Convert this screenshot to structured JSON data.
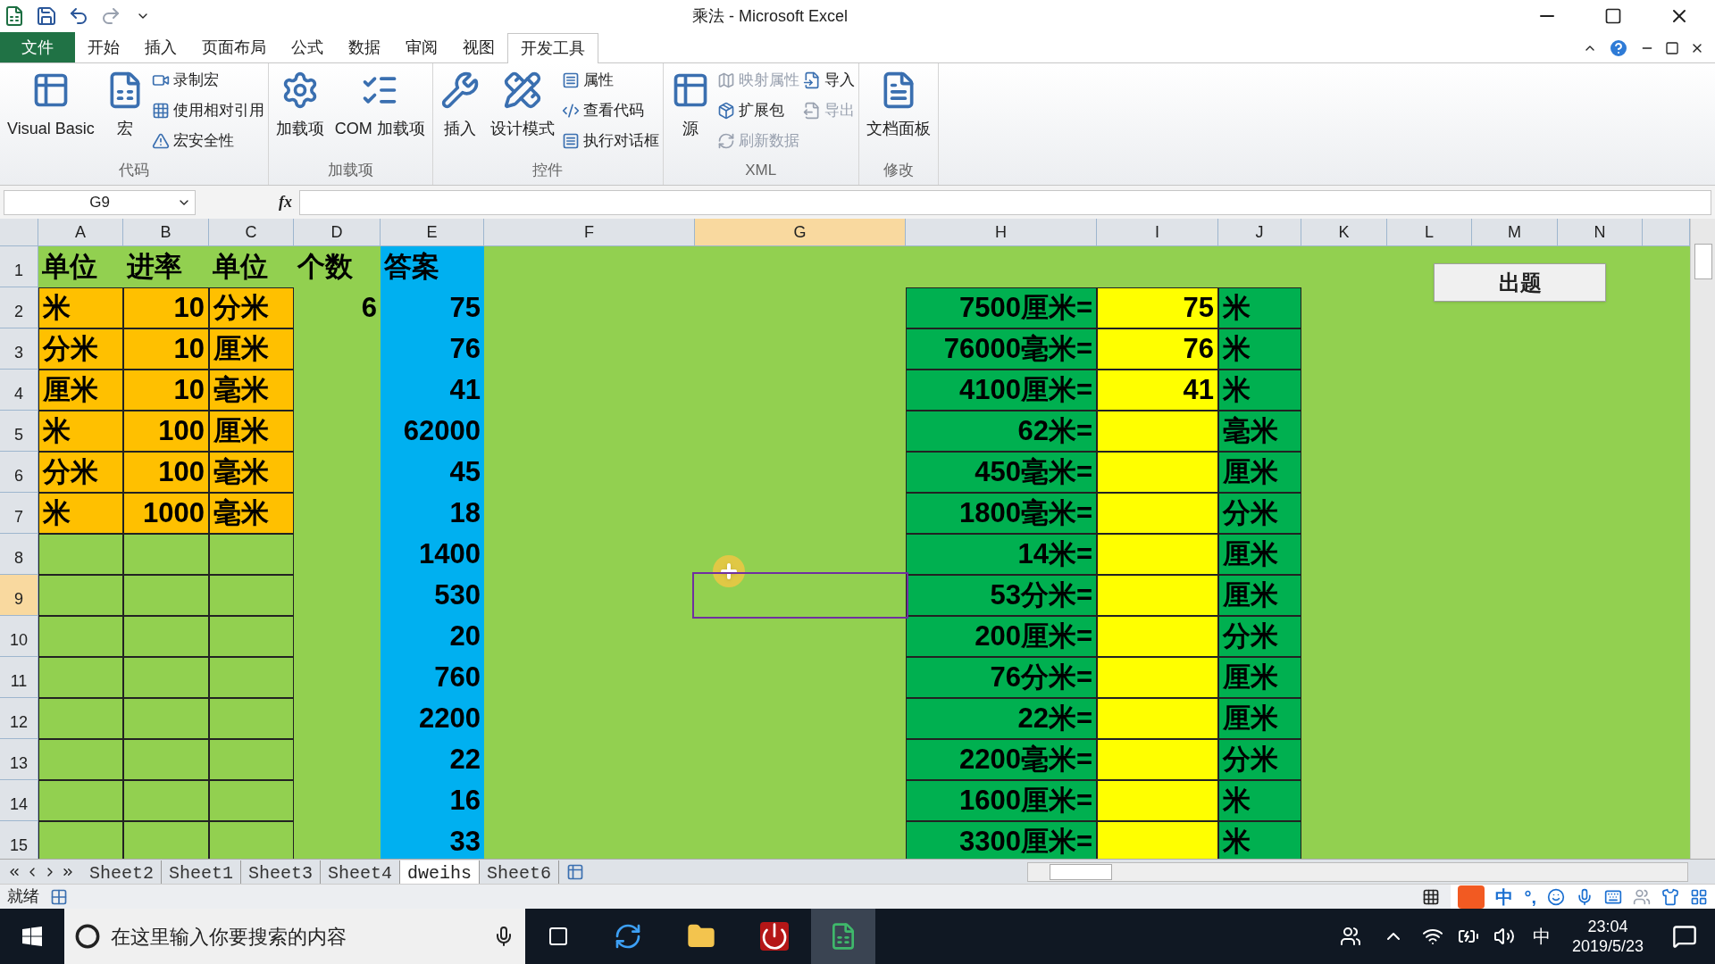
{
  "window": {
    "title": "乘法 - Microsoft Excel"
  },
  "ribbon_tabs": [
    {
      "label": "文件",
      "kind": "file",
      "selected": false
    },
    {
      "label": "开始",
      "kind": "tab",
      "selected": false
    },
    {
      "label": "插入",
      "kind": "tab",
      "selected": false
    },
    {
      "label": "页面布局",
      "kind": "tab",
      "selected": false
    },
    {
      "label": "公式",
      "kind": "tab",
      "selected": false
    },
    {
      "label": "数据",
      "kind": "tab",
      "selected": false
    },
    {
      "label": "审阅",
      "kind": "tab",
      "selected": false
    },
    {
      "label": "视图",
      "kind": "tab",
      "selected": false
    },
    {
      "label": "开发工具",
      "kind": "tab",
      "selected": true
    }
  ],
  "ribbon_groups": [
    {
      "label": "代码",
      "items": [
        {
          "kind": "large",
          "label": "Visual Basic",
          "disabled": false
        },
        {
          "kind": "large",
          "label": "宏",
          "disabled": false
        },
        {
          "kind": "stack",
          "items": [
            {
              "label": "录制宏",
              "disabled": false
            },
            {
              "label": "使用相对引用",
              "disabled": false
            },
            {
              "label": "宏安全性",
              "disabled": false
            }
          ]
        }
      ]
    },
    {
      "label": "加载项",
      "items": [
        {
          "kind": "large",
          "label": "加载项",
          "disabled": false
        },
        {
          "kind": "large",
          "label": "COM 加载项",
          "disabled": false
        }
      ]
    },
    {
      "label": "控件",
      "items": [
        {
          "kind": "large",
          "label": "插入",
          "disabled": false
        },
        {
          "kind": "large",
          "label": "设计模式",
          "disabled": false
        },
        {
          "kind": "stack",
          "items": [
            {
              "label": "属性",
              "disabled": false
            },
            {
              "label": "查看代码",
              "disabled": false
            },
            {
              "label": "执行对话框",
              "disabled": false
            }
          ]
        }
      ]
    },
    {
      "label": "XML",
      "items": [
        {
          "kind": "large",
          "label": "源",
          "disabled": false
        },
        {
          "kind": "stack",
          "items": [
            {
              "label": "映射属性",
              "disabled": true
            },
            {
              "label": "扩展包",
              "disabled": false
            },
            {
              "label": "刷新数据",
              "disabled": true
            }
          ]
        },
        {
          "kind": "stack",
          "items": [
            {
              "label": "导入",
              "disabled": false
            },
            {
              "label": "导出",
              "disabled": true
            }
          ]
        }
      ]
    },
    {
      "label": "修改",
      "items": [
        {
          "kind": "large",
          "label": "文档面板",
          "disabled": false
        }
      ]
    }
  ],
  "formula_bar": {
    "name_box": "G9",
    "fx": "fx"
  },
  "columns": [
    {
      "label": "A",
      "selected": false
    },
    {
      "label": "B",
      "selected": false
    },
    {
      "label": "C",
      "selected": false
    },
    {
      "label": "D",
      "selected": false
    },
    {
      "label": "E",
      "selected": false
    },
    {
      "label": "F",
      "selected": false
    },
    {
      "label": "G",
      "selected": true
    },
    {
      "label": "H",
      "selected": false
    },
    {
      "label": "I",
      "selected": false
    },
    {
      "label": "J",
      "selected": false
    },
    {
      "label": "K",
      "selected": false
    },
    {
      "label": "L",
      "selected": false
    },
    {
      "label": "M",
      "selected": false
    },
    {
      "label": "N",
      "selected": false
    }
  ],
  "rows": [
    {
      "label": "1",
      "selected": false,
      "cells": [
        {
          "text": "单位",
          "kind": "text",
          "color": "#92d050",
          "bordered": false
        },
        {
          "text": "进率",
          "kind": "text",
          "color": "#92d050",
          "bordered": false
        },
        {
          "text": "单位",
          "kind": "text",
          "color": "#92d050",
          "bordered": false
        },
        {
          "text": "个数",
          "kind": "text",
          "color": "#92d050",
          "bordered": false
        },
        {
          "text": "答案",
          "kind": "text",
          "color": "#00b0f0",
          "bordered": false
        },
        null,
        null,
        null,
        null,
        null
      ]
    },
    {
      "label": "2",
      "selected": false,
      "cells": [
        {
          "text": "米",
          "kind": "text",
          "color": "#ffc000",
          "bordered": true
        },
        {
          "text": "10",
          "kind": "number",
          "color": "#ffc000",
          "bordered": true
        },
        {
          "text": "分米",
          "kind": "text",
          "color": "#ffc000",
          "bordered": true
        },
        {
          "text": "6",
          "kind": "number",
          "color": "#92d050",
          "bordered": false
        },
        {
          "text": "75",
          "kind": "number",
          "color": "#00b0f0",
          "bordered": false
        },
        null,
        null,
        {
          "text": "7500厘米=",
          "kind": "number",
          "color": "#00b050",
          "bordered": true
        },
        {
          "text": "75",
          "kind": "number",
          "color": "#ffff00",
          "bordered": true
        },
        {
          "text": "米",
          "kind": "text",
          "color": "#00b050",
          "bordered": true
        }
      ]
    },
    {
      "label": "3",
      "selected": false,
      "cells": [
        {
          "text": "分米",
          "kind": "text",
          "color": "#ffc000",
          "bordered": true
        },
        {
          "text": "10",
          "kind": "number",
          "color": "#ffc000",
          "bordered": true
        },
        {
          "text": "厘米",
          "kind": "text",
          "color": "#ffc000",
          "bordered": true
        },
        null,
        {
          "text": "76",
          "kind": "number",
          "color": "#00b0f0",
          "bordered": false
        },
        null,
        null,
        {
          "text": "76000毫米=",
          "kind": "number",
          "color": "#00b050",
          "bordered": true
        },
        {
          "text": "76",
          "kind": "number",
          "color": "#ffff00",
          "bordered": true
        },
        {
          "text": "米",
          "kind": "text",
          "color": "#00b050",
          "bordered": true
        }
      ]
    },
    {
      "label": "4",
      "selected": false,
      "cells": [
        {
          "text": "厘米",
          "kind": "text",
          "color": "#ffc000",
          "bordered": true
        },
        {
          "text": "10",
          "kind": "number",
          "color": "#ffc000",
          "bordered": true
        },
        {
          "text": "毫米",
          "kind": "text",
          "color": "#ffc000",
          "bordered": true
        },
        null,
        {
          "text": "41",
          "kind": "number",
          "color": "#00b0f0",
          "bordered": false
        },
        null,
        null,
        {
          "text": "4100厘米=",
          "kind": "number",
          "color": "#00b050",
          "bordered": true
        },
        {
          "text": "41",
          "kind": "number",
          "color": "#ffff00",
          "bordered": true
        },
        {
          "text": "米",
          "kind": "text",
          "color": "#00b050",
          "bordered": true
        }
      ]
    },
    {
      "label": "5",
      "selected": false,
      "cells": [
        {
          "text": "米",
          "kind": "text",
          "color": "#ffc000",
          "bordered": true
        },
        {
          "text": "100",
          "kind": "number",
          "color": "#ffc000",
          "bordered": true
        },
        {
          "text": "厘米",
          "kind": "text",
          "color": "#ffc000",
          "bordered": true
        },
        null,
        {
          "text": "62000",
          "kind": "number",
          "color": "#00b0f0",
          "bordered": false
        },
        null,
        null,
        {
          "text": "62米=",
          "kind": "number",
          "color": "#00b050",
          "bordered": true
        },
        {
          "color": "#ffff00",
          "bordered": true
        },
        {
          "text": "毫米",
          "kind": "text",
          "color": "#00b050",
          "bordered": true
        }
      ]
    },
    {
      "label": "6",
      "selected": false,
      "cells": [
        {
          "text": "分米",
          "kind": "text",
          "color": "#ffc000",
          "bordered": true
        },
        {
          "text": "100",
          "kind": "number",
          "color": "#ffc000",
          "bordered": true
        },
        {
          "text": "毫米",
          "kind": "text",
          "color": "#ffc000",
          "bordered": true
        },
        null,
        {
          "text": "45",
          "kind": "number",
          "color": "#00b0f0",
          "bordered": false
        },
        null,
        null,
        {
          "text": "450毫米=",
          "kind": "number",
          "color": "#00b050",
          "bordered": true
        },
        {
          "color": "#ffff00",
          "bordered": true
        },
        {
          "text": "厘米",
          "kind": "text",
          "color": "#00b050",
          "bordered": true
        }
      ]
    },
    {
      "label": "7",
      "selected": false,
      "cells": [
        {
          "text": "米",
          "kind": "text",
          "color": "#ffc000",
          "bordered": true
        },
        {
          "text": "1000",
          "kind": "number",
          "color": "#ffc000",
          "bordered": true
        },
        {
          "text": "毫米",
          "kind": "text",
          "color": "#ffc000",
          "bordered": true
        },
        null,
        {
          "text": "18",
          "kind": "number",
          "color": "#00b0f0",
          "bordered": false
        },
        null,
        null,
        {
          "text": "1800毫米=",
          "kind": "number",
          "color": "#00b050",
          "bordered": true
        },
        {
          "color": "#ffff00",
          "bordered": true
        },
        {
          "text": "分米",
          "kind": "text",
          "color": "#00b050",
          "bordered": true
        }
      ]
    },
    {
      "label": "8",
      "selected": false,
      "cells": [
        {
          "color": "#92d050",
          "bordered": true
        },
        {
          "color": "#92d050",
          "bordered": true
        },
        {
          "color": "#92d050",
          "bordered": true
        },
        null,
        {
          "text": "1400",
          "kind": "number",
          "color": "#00b0f0",
          "bordered": false
        },
        null,
        null,
        {
          "text": "14米=",
          "kind": "number",
          "color": "#00b050",
          "bordered": true
        },
        {
          "color": "#ffff00",
          "bordered": true
        },
        {
          "text": "厘米",
          "kind": "text",
          "color": "#00b050",
          "bordered": true
        }
      ]
    },
    {
      "label": "9",
      "selected": true,
      "cells": [
        {
          "color": "#92d050",
          "bordered": true
        },
        {
          "color": "#92d050",
          "bordered": true
        },
        {
          "color": "#92d050",
          "bordered": true
        },
        null,
        {
          "text": "530",
          "kind": "number",
          "color": "#00b0f0",
          "bordered": false
        },
        null,
        null,
        {
          "text": "53分米=",
          "kind": "number",
          "color": "#00b050",
          "bordered": true
        },
        {
          "color": "#ffff00",
          "bordered": true
        },
        {
          "text": "厘米",
          "kind": "text",
          "color": "#00b050",
          "bordered": true
        }
      ]
    },
    {
      "label": "10",
      "selected": false,
      "cells": [
        {
          "color": "#92d050",
          "bordered": true
        },
        {
          "color": "#92d050",
          "bordered": true
        },
        {
          "color": "#92d050",
          "bordered": true
        },
        null,
        {
          "text": "20",
          "kind": "number",
          "color": "#00b0f0",
          "bordered": false
        },
        null,
        null,
        {
          "text": "200厘米=",
          "kind": "number",
          "color": "#00b050",
          "bordered": true
        },
        {
          "color": "#ffff00",
          "bordered": true
        },
        {
          "text": "分米",
          "kind": "text",
          "color": "#00b050",
          "bordered": true
        }
      ]
    },
    {
      "label": "11",
      "selected": false,
      "cells": [
        {
          "color": "#92d050",
          "bordered": true
        },
        {
          "color": "#92d050",
          "bordered": true
        },
        {
          "color": "#92d050",
          "bordered": true
        },
        null,
        {
          "text": "760",
          "kind": "number",
          "color": "#00b0f0",
          "bordered": false
        },
        null,
        null,
        {
          "text": "76分米=",
          "kind": "number",
          "color": "#00b050",
          "bordered": true
        },
        {
          "color": "#ffff00",
          "bordered": true
        },
        {
          "text": "厘米",
          "kind": "text",
          "color": "#00b050",
          "bordered": true
        }
      ]
    },
    {
      "label": "12",
      "selected": false,
      "cells": [
        {
          "color": "#92d050",
          "bordered": true
        },
        {
          "color": "#92d050",
          "bordered": true
        },
        {
          "color": "#92d050",
          "bordered": true
        },
        null,
        {
          "text": "2200",
          "kind": "number",
          "color": "#00b0f0",
          "bordered": false
        },
        null,
        null,
        {
          "text": "22米=",
          "kind": "number",
          "color": "#00b050",
          "bordered": true
        },
        {
          "color": "#ffff00",
          "bordered": true
        },
        {
          "text": "厘米",
          "kind": "text",
          "color": "#00b050",
          "bordered": true
        }
      ]
    },
    {
      "label": "13",
      "selected": false,
      "cells": [
        {
          "color": "#92d050",
          "bordered": true
        },
        {
          "color": "#92d050",
          "bordered": true
        },
        {
          "color": "#92d050",
          "bordered": true
        },
        null,
        {
          "text": "22",
          "kind": "number",
          "color": "#00b0f0",
          "bordered": false
        },
        null,
        null,
        {
          "text": "2200毫米=",
          "kind": "number",
          "color": "#00b050",
          "bordered": true
        },
        {
          "color": "#ffff00",
          "bordered": true
        },
        {
          "text": "分米",
          "kind": "text",
          "color": "#00b050",
          "bordered": true
        }
      ]
    },
    {
      "label": "14",
      "selected": false,
      "cells": [
        {
          "color": "#92d050",
          "bordered": true
        },
        {
          "color": "#92d050",
          "bordered": true
        },
        {
          "color": "#92d050",
          "bordered": true
        },
        null,
        {
          "text": "16",
          "kind": "number",
          "color": "#00b0f0",
          "bordered": false
        },
        null,
        null,
        {
          "text": "1600厘米=",
          "kind": "number",
          "color": "#00b050",
          "bordered": true
        },
        {
          "color": "#ffff00",
          "bordered": true
        },
        {
          "text": "米",
          "kind": "text",
          "color": "#00b050",
          "bordered": true
        }
      ]
    },
    {
      "label": "15",
      "selected": false,
      "cells": [
        {
          "color": "#92d050",
          "bordered": true
        },
        {
          "color": "#92d050",
          "bordered": true
        },
        {
          "color": "#92d050",
          "bordered": true
        },
        null,
        {
          "text": "33",
          "kind": "number",
          "color": "#00b0f0",
          "bordered": false
        },
        null,
        null,
        {
          "text": "3300厘米=",
          "kind": "number",
          "color": "#00b050",
          "bordered": true
        },
        {
          "color": "#ffff00",
          "bordered": true
        },
        {
          "text": "米",
          "kind": "text",
          "color": "#00b050",
          "bordered": true
        }
      ]
    }
  ],
  "sheet_button": {
    "label": "出题"
  },
  "sheet_tabs": [
    {
      "label": "Sheet2",
      "selected": false
    },
    {
      "label": "Sheet1",
      "selected": false
    },
    {
      "label": "Sheet3",
      "selected": false
    },
    {
      "label": "Sheet4",
      "selected": false
    },
    {
      "label": "dweihs",
      "selected": true
    },
    {
      "label": "Sheet6",
      "selected": false
    }
  ],
  "status_bar": {
    "text": "就绪"
  },
  "ime_bar": {
    "mode": "中",
    "punct": "°,"
  },
  "taskbar": {
    "search_placeholder": "在这里输入你要搜索的内容",
    "tray_ime": "中",
    "time": "23:04",
    "date": "2019/5/23"
  }
}
